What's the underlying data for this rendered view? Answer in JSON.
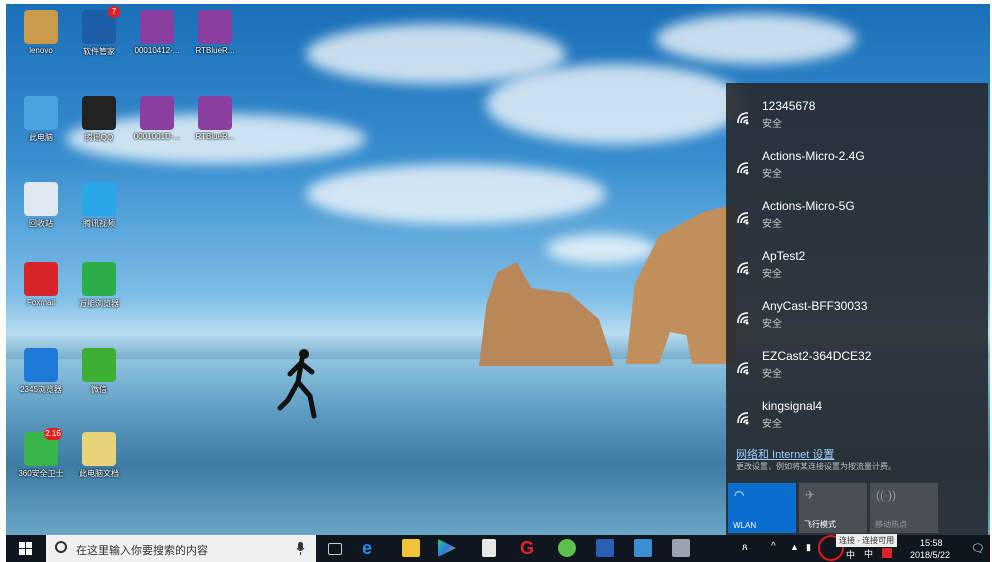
{
  "desktop": {
    "icons": [
      {
        "label": "lenovo",
        "icon": "lenovo-user-icon",
        "color": "#c89a4a"
      },
      {
        "label": "软件管家",
        "icon": "software-manager-icon",
        "color": "#1d5ea8",
        "badge": "7"
      },
      {
        "label": "00010412-...",
        "icon": "winrar-archive-icon",
        "color": "#8a3ea0"
      },
      {
        "label": "RTBlueR...",
        "icon": "winrar-archive-icon",
        "color": "#8a3ea0"
      },
      {
        "label": "此电脑",
        "icon": "this-pc-icon",
        "color": "#4aa3e0"
      },
      {
        "label": "腾讯QQ",
        "icon": "qq-penguin-icon",
        "color": "#222222"
      },
      {
        "label": "0001001D-...",
        "icon": "winrar-archive-icon",
        "color": "#8a3ea0"
      },
      {
        "label": "RTBlueR...",
        "icon": "winrar-archive-icon",
        "color": "#8a3ea0"
      },
      {
        "label": "回收站",
        "icon": "recycle-bin-icon",
        "color": "#dfe8ee"
      },
      {
        "label": "腾讯视频",
        "icon": "tencent-video-icon",
        "color": "#2aa6e8"
      },
      {
        "label": "Foxmail",
        "icon": "foxmail-icon",
        "color": "#d8242a"
      },
      {
        "label": "万能浏览器",
        "icon": "browser-e-icon",
        "color": "#2bae4a"
      },
      {
        "label": "2345浏览器",
        "icon": "ie-browser-icon",
        "color": "#1e7ad6"
      },
      {
        "label": "微信",
        "icon": "wechat-icon",
        "color": "#3cb034"
      },
      {
        "label": "360安全卫士",
        "icon": "360-guard-icon",
        "color": "#3ab54a",
        "badge": "2.16"
      },
      {
        "label": "此电脑文档",
        "icon": "document-icon",
        "color": "#e8d27a"
      }
    ]
  },
  "wifi_panel": {
    "networks": [
      {
        "name": "12345678",
        "status": "安全"
      },
      {
        "name": "Actions-Micro-2.4G",
        "status": "安全"
      },
      {
        "name": "Actions-Micro-5G",
        "status": "安全"
      },
      {
        "name": "ApTest2",
        "status": "安全"
      },
      {
        "name": "AnyCast-BFF30033",
        "status": "安全"
      },
      {
        "name": "EZCast2-364DCE32",
        "status": "安全"
      },
      {
        "name": "kingsignal4",
        "status": "安全"
      }
    ],
    "settings_link": "网络和 Internet 设置",
    "settings_desc": "更改设置，例如将某连接设置为按流量计费。",
    "tiles": [
      {
        "label": "WLAN",
        "icon": "wifi-icon",
        "active": true
      },
      {
        "label": "飞行模式",
        "icon": "airplane-icon",
        "active": false
      },
      {
        "label": "移动热点",
        "icon": "hotspot-icon",
        "active": false
      }
    ]
  },
  "taskbar": {
    "search_placeholder": "在这里输入你要搜索的内容",
    "tooltip": "连接 - 连接可用",
    "time": "15:58",
    "date": "2018/5/22",
    "ime": "中"
  },
  "colors": {
    "accent": "#0a6ed1",
    "tile_inactive": "#4a4f55",
    "panel_bg": "#2c3036",
    "taskbar_bg": "#10161d",
    "highlight_circle": "#e01a1a"
  }
}
